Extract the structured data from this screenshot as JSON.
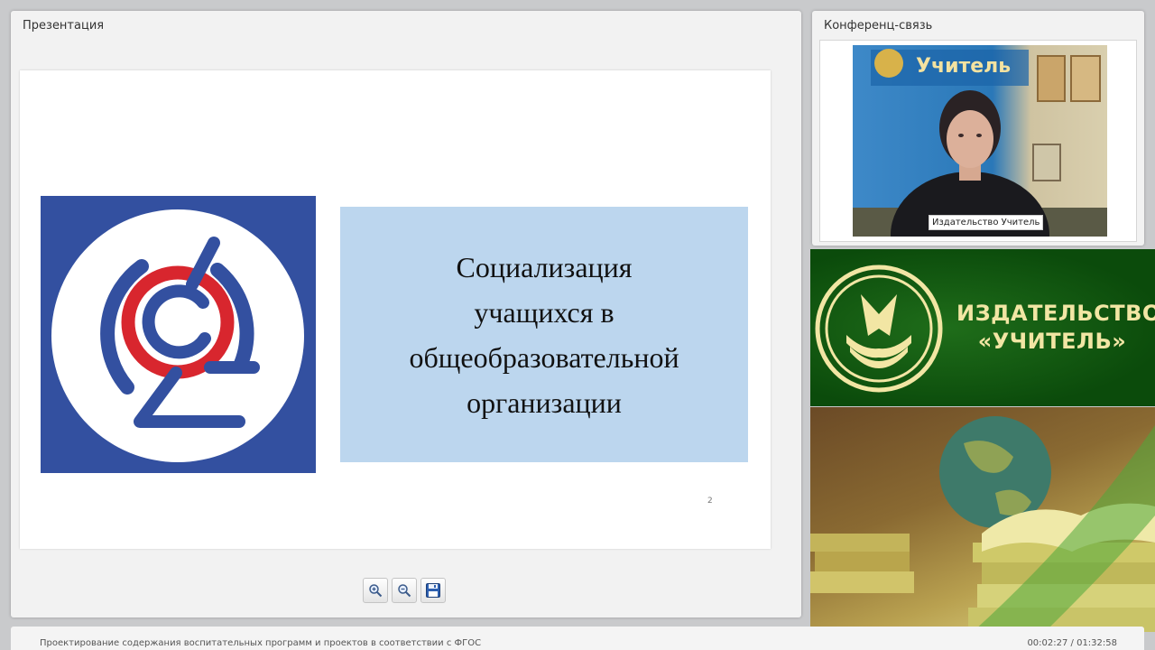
{
  "presentation": {
    "title": "Презентация",
    "slide": {
      "title": "Социализация\nучащихся в\nобщеобразовательной\nорганизации",
      "number": "2"
    },
    "toolbar": {
      "zoom_in_icon": "zoom-in-icon",
      "zoom_out_icon": "zoom-out-icon",
      "save_icon": "floppy-disk-icon"
    }
  },
  "conference": {
    "title": "Конференц-связь",
    "speaker_name": "Издательство Учитель"
  },
  "publisher": {
    "name": "ИЗДАТЕЛЬСТВО\n«УЧИТЕЛЬ»"
  },
  "footer": {
    "course_title": "Проектирование содержания воспитательных программ и проектов в соответствии с ФГОС",
    "playback_time": "00:02:27 / 01:32:58"
  },
  "colors": {
    "logo_blue": "#3350a0",
    "logo_red": "#d8262e",
    "slide_title_bg": "#bcd6ee",
    "publisher_green": "#0f5310",
    "publisher_gold": "#f2e6a4"
  }
}
